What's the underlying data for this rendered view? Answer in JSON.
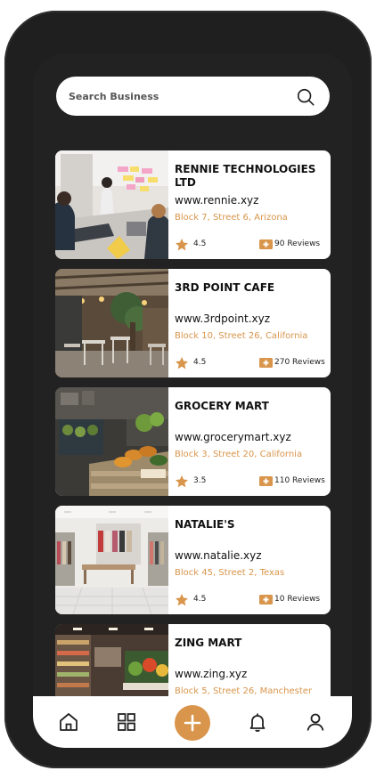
{
  "search": {
    "placeholder": "Search Business",
    "icon": "search-icon"
  },
  "colors": {
    "accent": "#d8954b",
    "frame": "#1f1f1f",
    "card": "#ffffff"
  },
  "businesses": [
    {
      "name": "RENNIE TECHNOLOGIES LTD",
      "url": "www.rennie.xyz",
      "address": "Block 7, Street 6, Arizona",
      "rating": "4.5",
      "reviews": "90 Reviews"
    },
    {
      "name": "3RD POINT CAFE",
      "url": "www.3rdpoint.xyz",
      "address": "Block 10, Street 26, California",
      "rating": "4.5",
      "reviews": "270 Reviews"
    },
    {
      "name": "GROCERY MART",
      "url": "www.grocerymart.xyz",
      "address": "Block 3, Street 20, California",
      "rating": "3.5",
      "reviews": "110 Reviews"
    },
    {
      "name": "NATALIE'S",
      "url": "www.natalie.xyz",
      "address": "Block 45, Street 2, Texas",
      "rating": "4.5",
      "reviews": "10 Reviews"
    },
    {
      "name": "ZING MART",
      "url": "www.zing.xyz",
      "address": "Block 5, Street 26, Manchester",
      "rating": "",
      "reviews": ""
    }
  ],
  "nav": {
    "items": [
      {
        "icon": "home-icon"
      },
      {
        "icon": "grid-icon"
      },
      {
        "icon": "plus-icon"
      },
      {
        "icon": "bell-icon"
      },
      {
        "icon": "user-icon"
      }
    ]
  }
}
